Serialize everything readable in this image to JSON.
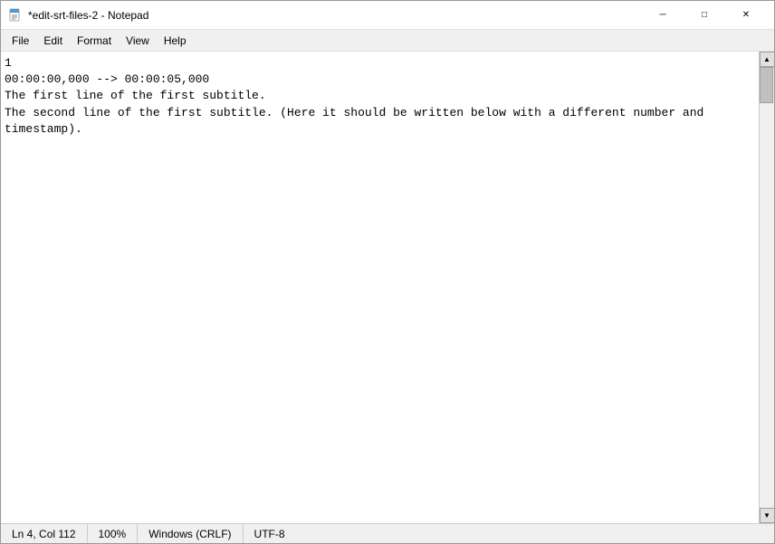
{
  "window": {
    "title": "*edit-srt-files-2 - Notepad",
    "icon": "notepad"
  },
  "titlebar": {
    "minimize_label": "─",
    "maximize_label": "□",
    "close_label": "✕"
  },
  "menu": {
    "items": [
      {
        "id": "file",
        "label": "File"
      },
      {
        "id": "edit",
        "label": "Edit"
      },
      {
        "id": "format",
        "label": "Format"
      },
      {
        "id": "view",
        "label": "View"
      },
      {
        "id": "help",
        "label": "Help"
      }
    ]
  },
  "editor": {
    "content_lines": [
      "1",
      "00:00:00,000 --> 00:00:05,000",
      "The first line of the first subtitle.",
      "The second line of the first subtitle. (Here it should be written below with a different number and",
      "timestamp)."
    ]
  },
  "statusbar": {
    "position": "Ln 4, Col 112",
    "zoom": "100%",
    "line_ending": "Windows (CRLF)",
    "encoding": "UTF-8"
  }
}
